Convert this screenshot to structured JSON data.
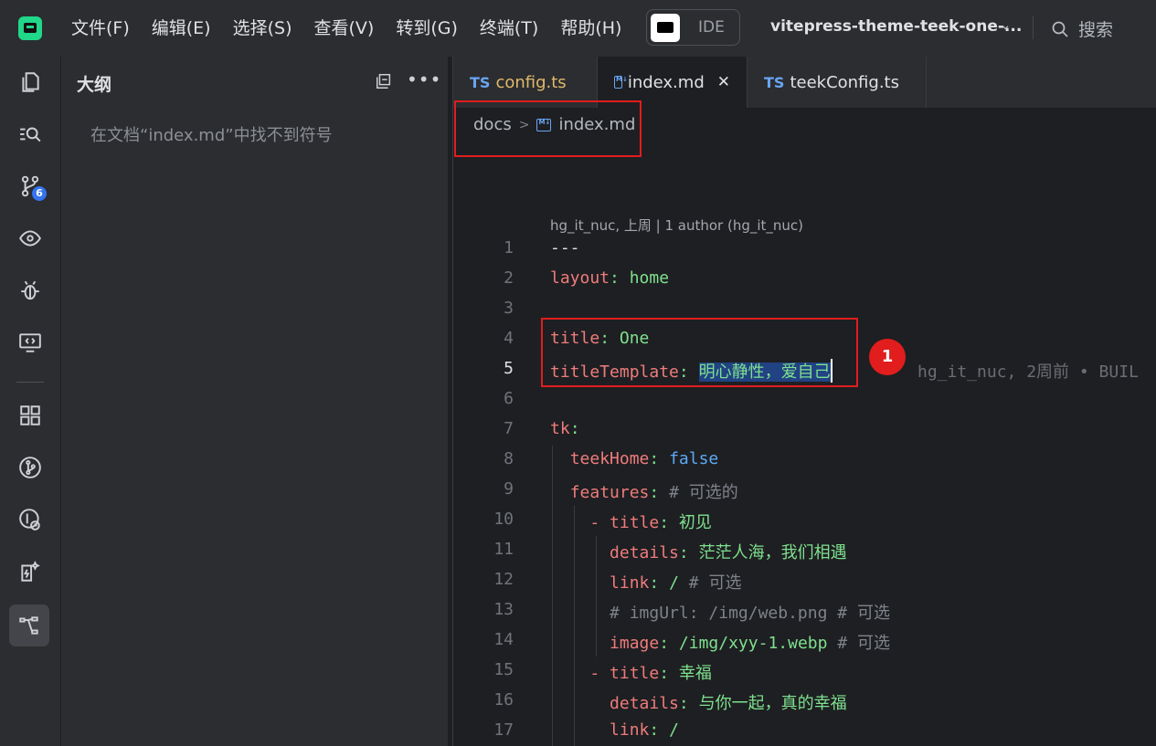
{
  "menu": [
    "文件(F)",
    "编辑(E)",
    "选择(S)",
    "查看(V)",
    "转到(G)",
    "终端(T)",
    "帮助(H)"
  ],
  "ide_label": "IDE",
  "project_name": "vitepress-theme-teek-one-...",
  "search_label": "搜索",
  "activity_bar": {
    "items": [
      "explorer-icon",
      "search-icon",
      "source-control-icon",
      "preview-icon",
      "debug-icon",
      "remote-icon",
      "extensions-icon",
      "git-graph-icon",
      "git-history-icon",
      "ai-icon",
      "outline-icon"
    ],
    "source_control_badge": "6"
  },
  "outline": {
    "title": "大纲",
    "empty_message": "在文档“index.md”中找不到符号"
  },
  "tabs": [
    {
      "prefix": "TS",
      "label": "config.ts"
    },
    {
      "label": "index.md",
      "active": true,
      "close": "✕"
    },
    {
      "prefix": "TS",
      "label": "teekConfig.ts"
    }
  ],
  "breadcrumb": {
    "folder": "docs",
    "file": "index.md"
  },
  "blame_header": "hg_it_nuc, 上周 | 1 author (hg_it_nuc)",
  "current_line_blame": "hg_it_nuc, 2周前 • BUIL",
  "annotation_marker": "1",
  "code_lines": [
    {
      "n": "1",
      "text": "---"
    },
    {
      "n": "2",
      "key": "layout",
      "value": "home"
    },
    {
      "n": "3",
      "text": ""
    },
    {
      "n": "4",
      "key": "title",
      "value": "One"
    },
    {
      "n": "5",
      "key": "titleTemplate",
      "value": "明心静性，爱自己"
    },
    {
      "n": "6",
      "text": ""
    },
    {
      "n": "7",
      "key": "tk",
      "value": ""
    },
    {
      "n": "8",
      "indent": "  ",
      "key": "teekHome",
      "value": "false"
    },
    {
      "n": "9",
      "indent": "  ",
      "key": "features",
      "comment": "# 可选的"
    },
    {
      "n": "10",
      "indent": "    - ",
      "key": "title",
      "value": "初见"
    },
    {
      "n": "11",
      "indent": "      ",
      "key": "details",
      "value": "茫茫人海，我们相遇"
    },
    {
      "n": "12",
      "indent": "      ",
      "key": "link",
      "value": "/",
      "comment": "# 可选"
    },
    {
      "n": "13",
      "indent": "      ",
      "comment": "# imgUrl: /img/web.png # 可选"
    },
    {
      "n": "14",
      "indent": "      ",
      "key": "image",
      "value": "/img/xyy-1.webp",
      "comment": "# 可选"
    },
    {
      "n": "15",
      "indent": "    - ",
      "key": "title",
      "value": "幸福"
    },
    {
      "n": "16",
      "indent": "      ",
      "key": "details",
      "value": "与你一起，真的幸福"
    },
    {
      "n": "17",
      "indent": "      ",
      "key": "link",
      "value": "/"
    }
  ],
  "colors": {
    "key": "#ef7c7c",
    "string": "#7ee08e",
    "boolean": "#5da9f5",
    "comment": "#7e828a",
    "highlight_box": "#e11d1d"
  }
}
